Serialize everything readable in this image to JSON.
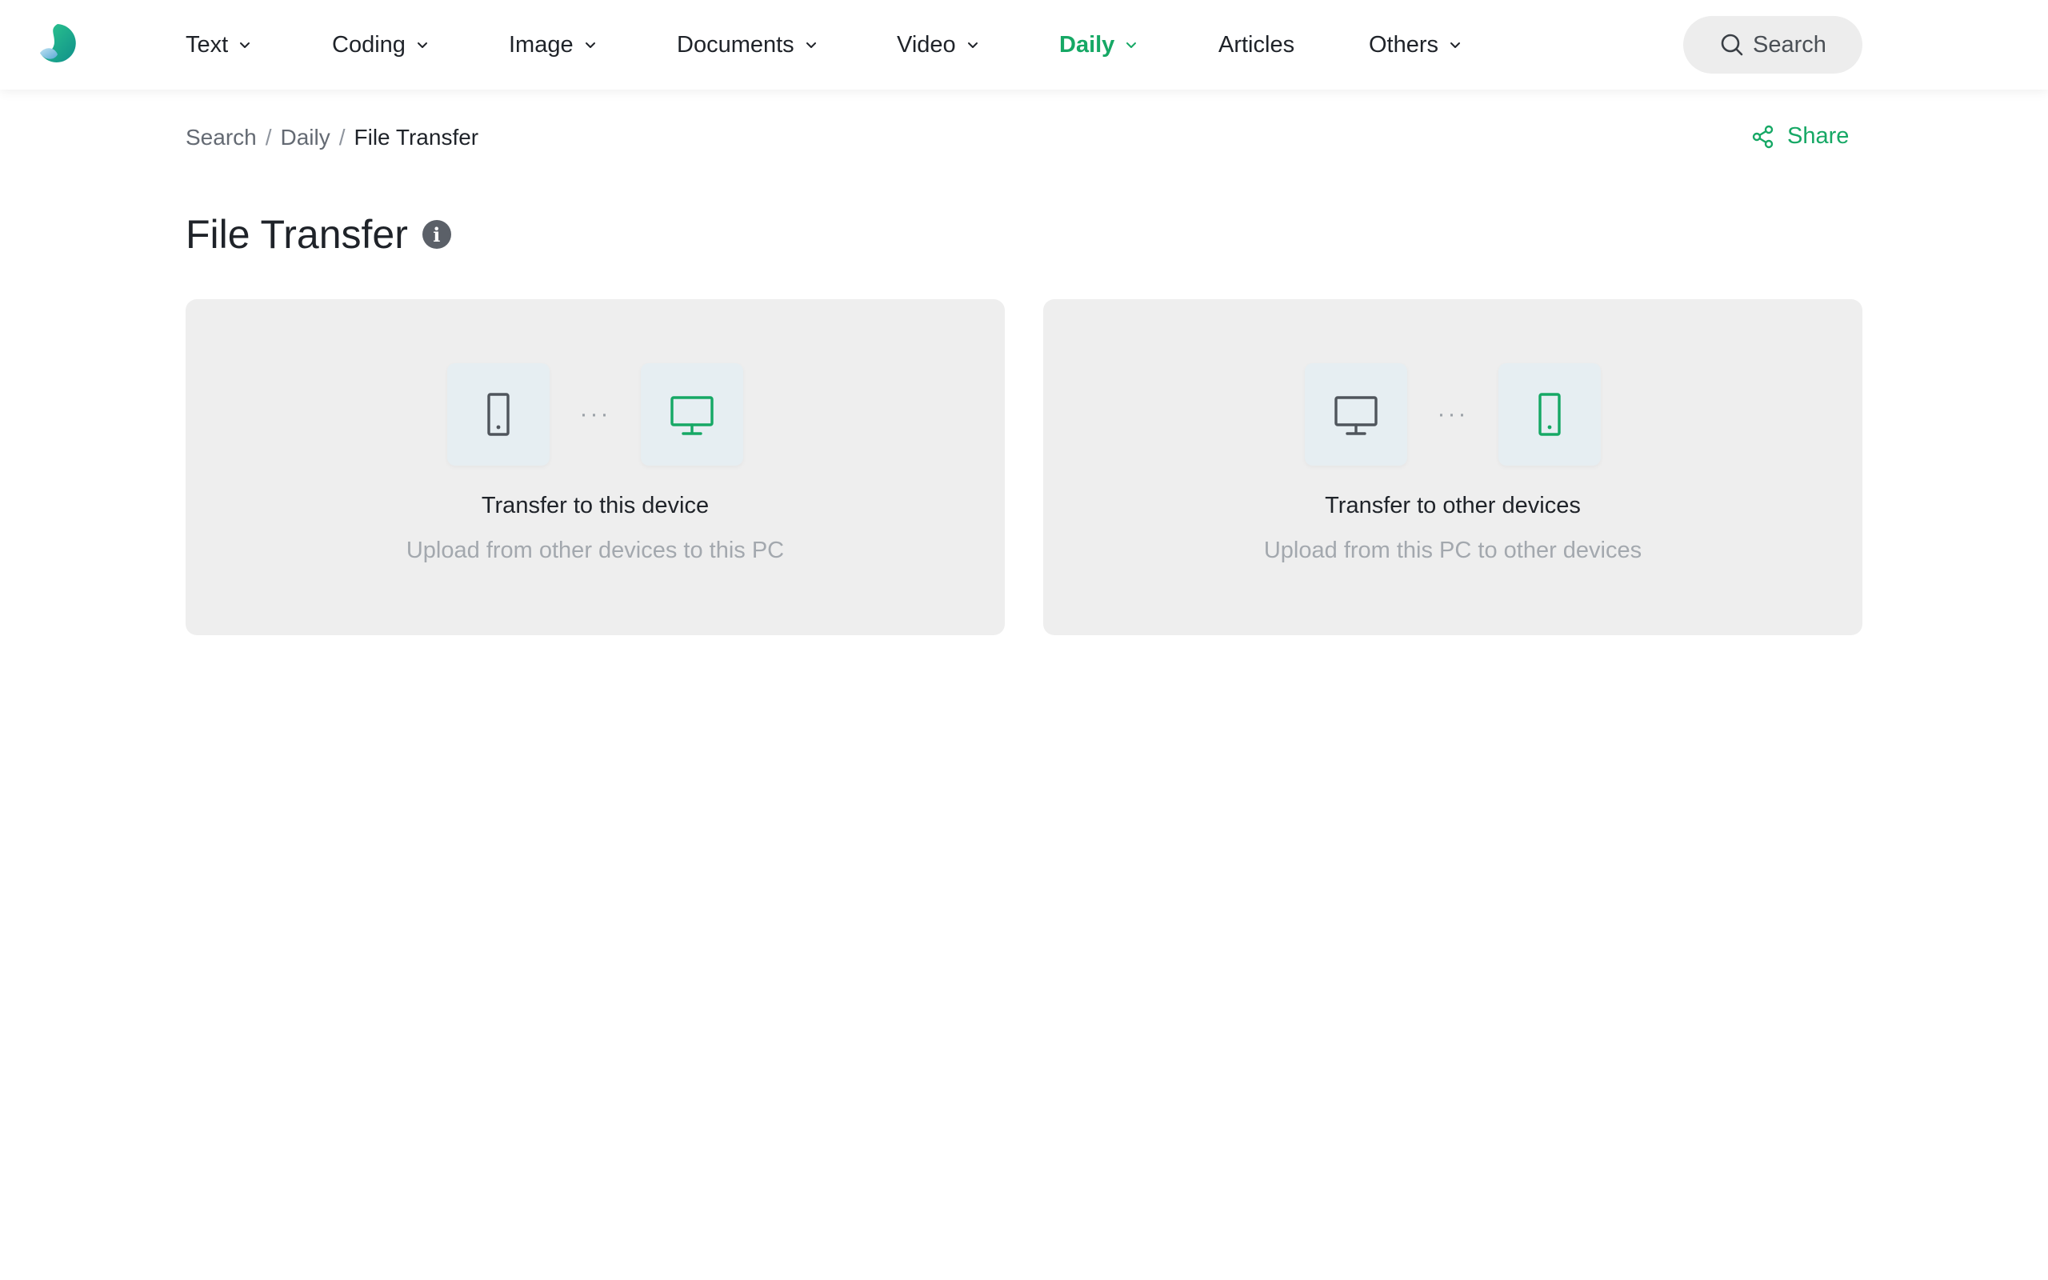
{
  "nav": {
    "items": [
      {
        "label": "Text",
        "has_dropdown": true,
        "active": false
      },
      {
        "label": "Coding",
        "has_dropdown": true,
        "active": false
      },
      {
        "label": "Image",
        "has_dropdown": true,
        "active": false
      },
      {
        "label": "Documents",
        "has_dropdown": true,
        "active": false
      },
      {
        "label": "Video",
        "has_dropdown": true,
        "active": false
      },
      {
        "label": "Daily",
        "has_dropdown": true,
        "active": true
      },
      {
        "label": "Articles",
        "has_dropdown": false,
        "active": false
      },
      {
        "label": "Others",
        "has_dropdown": true,
        "active": false
      }
    ],
    "search_label": "Search"
  },
  "breadcrumb": [
    "Search",
    "Daily",
    "File Transfer"
  ],
  "share_label": "Share",
  "page": {
    "title": "File Transfer"
  },
  "cards": [
    {
      "title": "Transfer to this device",
      "subtitle": "Upload from other devices to this PC",
      "from_icon": "mobile-icon",
      "to_icon": "desktop-icon"
    },
    {
      "title": "Transfer to other devices",
      "subtitle": "Upload from this PC to other devices",
      "from_icon": "desktop-icon",
      "to_icon": "mobile-icon"
    }
  ],
  "colors": {
    "accent": "#16a865",
    "icon_gray": "#4f555c",
    "card_bg": "#eeeeee",
    "device_box_bg": "#e6eef2"
  }
}
